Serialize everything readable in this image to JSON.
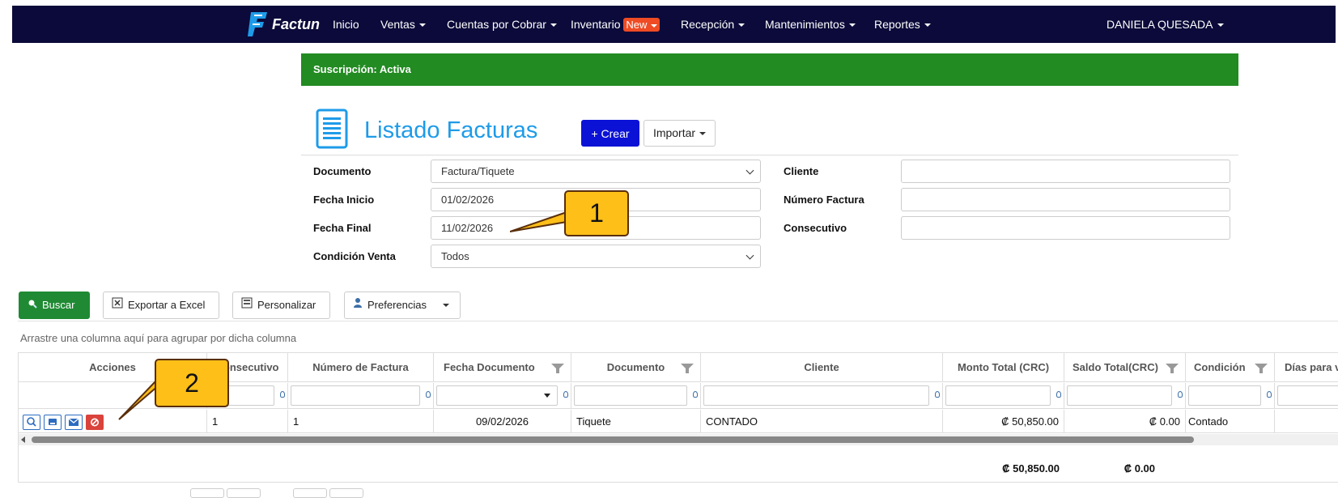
{
  "navbar": {
    "brand": "Factun",
    "items": [
      {
        "label": "Inicio"
      },
      {
        "label": "Ventas"
      },
      {
        "label": "Cuentas por Cobrar"
      },
      {
        "label": "Inventario"
      },
      {
        "label": "Recepción"
      },
      {
        "label": "Mantenimientos"
      },
      {
        "label": "Reportes"
      }
    ],
    "new_badge": "New",
    "user": "DANIELA QUESADA",
    "bg_color": "#0b0a3a"
  },
  "subscription": {
    "text": "Suscripción: Activa",
    "color": "#228b22"
  },
  "page": {
    "title": "Listado Facturas",
    "create_label": "+ Crear",
    "import_label": "Importar"
  },
  "filters": {
    "documento": {
      "label": "Documento",
      "value": "Factura/Tiquete"
    },
    "fecha_inicio": {
      "label": "Fecha Inicio",
      "value": "01/02/2026"
    },
    "fecha_final": {
      "label": "Fecha Final",
      "value": "11/02/2026"
    },
    "condicion_venta": {
      "label": "Condición Venta",
      "value": "Todos"
    },
    "cliente": {
      "label": "Cliente",
      "value": ""
    },
    "numero_factura": {
      "label": "Número Factura",
      "value": ""
    },
    "consecutivo": {
      "label": "Consecutivo",
      "value": ""
    }
  },
  "callouts": {
    "one": "1",
    "two": "2",
    "color": "#fdbf18"
  },
  "toolbar": {
    "search_label": "Buscar",
    "export_label": "Exportar a Excel",
    "customize_label": "Personalizar",
    "preferences_label": "Preferencias",
    "group_hint": "Arrastre una columna aquí para agrupar por dicha columna"
  },
  "grid": {
    "headers": {
      "acciones": "Acciones",
      "consecutivo": "Consecutivo",
      "numero_factura": "Número de Factura",
      "fecha_documento": "Fecha Documento",
      "documento": "Documento",
      "cliente": "Cliente",
      "monto_total": "Monto Total (CRC)",
      "saldo_total": "Saldo Total(CRC)",
      "condicion": "Condición",
      "dias": "Días para v"
    },
    "rows": [
      {
        "consecutivo": "1",
        "numero_factura": "1",
        "fecha_documento": "09/02/2026",
        "documento": "Tiquete",
        "cliente": "CONTADO",
        "monto_total": "₡ 50,850.00",
        "saldo_total": "₡ 0.00",
        "condicion": "Contado",
        "dias": ""
      }
    ],
    "totals": {
      "monto_total": "₡ 50,850.00",
      "saldo_total": "₡ 0.00"
    },
    "row_actions": [
      "zoom-icon",
      "print-icon",
      "email-icon",
      "cancel-icon"
    ]
  }
}
